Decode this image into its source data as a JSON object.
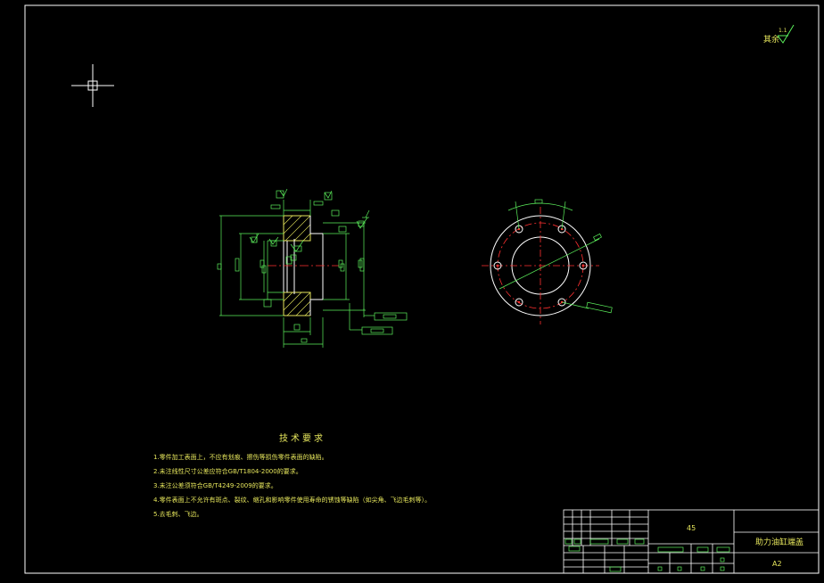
{
  "roughness": {
    "label": "其余",
    "value": "1.1"
  },
  "tech_requirements": {
    "title": "技术要求",
    "items": [
      "1.零件加工表面上，不应有划痕、擦伤等损伤零件表面的缺陷。",
      "2.未注线性尺寸公差应符合GB/T1804-2000的要求。",
      "3.未注公差须符合GB/T4249-2009的要求。",
      "4.零件表面上不允许有斑点、裂纹、缩孔和影响零件使用寿命的锈蚀等缺陷（如尖角、飞边毛刺等）。",
      "5.去毛刺、飞边。"
    ]
  },
  "title_block": {
    "material": "45",
    "part_name": "助力油缸端盖",
    "sheet_size": "A2"
  },
  "colors": {
    "background": "#000000",
    "frame": "#ffffff",
    "dimension": "#5cf05c",
    "hatch": "#e6e65c",
    "centerline": "#ff3030",
    "text": "#e6e65c"
  }
}
